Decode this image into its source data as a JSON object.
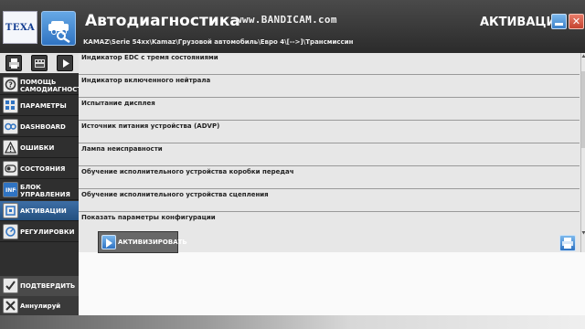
{
  "header": {
    "brand_logo": "TEXA",
    "app_title": "Автодиагностика",
    "watermark": "www.BANDICAM.com",
    "breadcrumb": "KAMAZ\\Serie 54xx\\Kamaz\\Грузовой автомобиль\\Евро 4\\[-->]\\Трансмиссин",
    "section_title": "АКТИВАЦИИ",
    "minimize_icon": "minimize-icon",
    "close_icon": "close-icon"
  },
  "toolbar": {
    "icons": [
      "printer-icon",
      "film-icon",
      "play-icon"
    ]
  },
  "sidebar": {
    "items": [
      {
        "label": "ПОМОЩЬ САМОДИАГНОСТ...",
        "icon": "help-icon",
        "active": false
      },
      {
        "label": "ПАРАМЕТРЫ",
        "icon": "parameters-icon",
        "active": false
      },
      {
        "label": "DASHBOARD",
        "icon": "dashboard-icon",
        "active": false
      },
      {
        "label": "ОШИБКИ",
        "icon": "warning-icon",
        "active": false
      },
      {
        "label": "СОСТОЯНИЯ",
        "icon": "states-icon",
        "active": false
      },
      {
        "label": "БЛОК УПРАВЛЕНИЯ",
        "icon": "ecu-info-icon",
        "active": false
      },
      {
        "label": "АКТИВАЦИИ",
        "icon": "activations-icon",
        "active": true
      },
      {
        "label": "РЕГУЛИРОВКИ",
        "icon": "adjustments-icon",
        "active": false
      }
    ],
    "confirm_label": "ПОДТВЕРДИТЬ",
    "cancel_label": "Аннулируй"
  },
  "main": {
    "rows": [
      "Индикатор EDC с тремя состояниями",
      "Индикатор включенного нейтрала",
      "Испытание дисплея",
      "Источник питания устройства (ADVP)",
      "Лампа неисправности",
      "Обучение исполнительного устройства коробки передач",
      "Обучение исполнительного устройства сцепления",
      "Показать параметры конфигурации"
    ],
    "activate_label": "АКТИВИЗИРОВАТЬ"
  },
  "colors": {
    "header_bg": "#2b2b2b",
    "sidebar_bg": "#2f2f2f",
    "active_blue": "#3d6ea6",
    "list_bg": "#e7e7e7",
    "close_red": "#c5432f"
  }
}
